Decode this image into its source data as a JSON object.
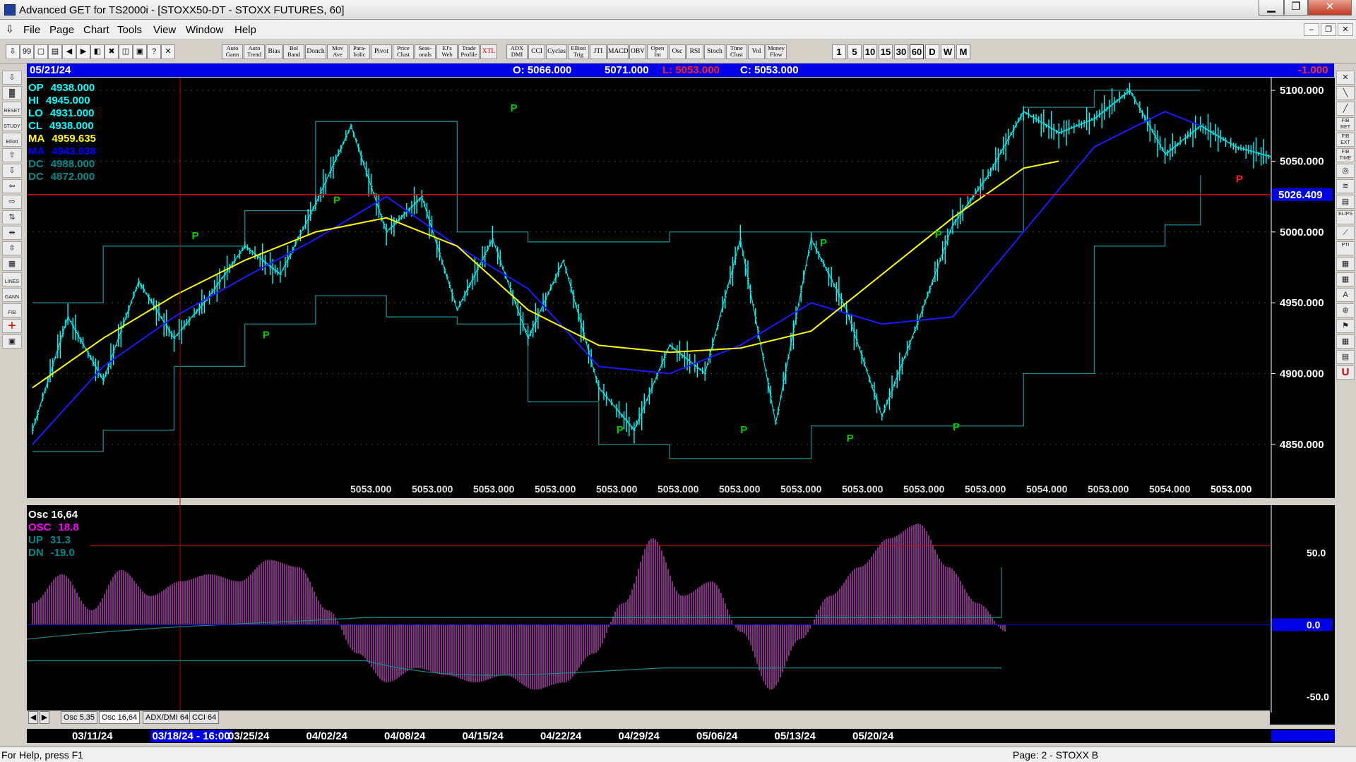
{
  "window": {
    "title": "Advanced GET for TS2000i - [STOXX50-DT - STOXX FUTURES, 60]",
    "btn_min": "▁",
    "btn_max": "❐",
    "btn_close": "✕"
  },
  "menu": {
    "items": [
      "File",
      "Page",
      "Chart",
      "Tools",
      "View",
      "Window",
      "Help"
    ],
    "mdi_min": "‒",
    "mdi_restore": "❐",
    "mdi_close": "✕"
  },
  "toolbar": {
    "file_buttons": [
      "⇩",
      "99",
      "▢",
      "▤",
      "◀",
      "▶",
      "◧",
      "✖",
      "◫",
      "▣",
      "?",
      "✕"
    ],
    "indicators": [
      "Auto\nGann",
      "Auto\nTrend",
      "Bias",
      "Bol\nBand",
      "Donch",
      "Mov\nAve",
      "Para-\nbolic",
      "Pivot",
      "Price\nClust",
      "Seas-\nonals",
      "EJ's\nWeb",
      "Trade\nProfile",
      "XTL",
      "ADX\nDMI",
      "CCI",
      "Cycles",
      "Elliott\nTrig",
      "JTI",
      "MACD",
      "OBV",
      "Open\nInt",
      "Osc",
      "RSI",
      "Stoch",
      "Time\nClust",
      "Vol",
      "Money\nFlow"
    ],
    "intervals": [
      "1",
      "5",
      "10",
      "15",
      "30",
      "60",
      "D",
      "W",
      "M"
    ],
    "active_interval": "60"
  },
  "left_tools": [
    "⇩",
    "▓",
    "RESET",
    "STUDY",
    "Elliott",
    "⇧",
    "⇩",
    "⇦",
    "⇨",
    "⇅",
    "⇹",
    "⇳",
    "▦",
    "LINES",
    "GANN",
    "FIB",
    "+",
    "▣"
  ],
  "right_tools": [
    "✕",
    "╲",
    "╱",
    "FIB RET",
    "FIB EXT",
    "FIB TIME",
    "◎",
    "≋",
    "▤",
    "ELIPS",
    "⟋",
    "PTI",
    "▦",
    "▦",
    "A",
    "⊕",
    "⚑",
    "▦",
    "▤",
    "U"
  ],
  "infobar": {
    "date": "05/21/24",
    "open": "O: 5066.000",
    "high": "5071.000",
    "low": "L: 5053.000",
    "close": "C: 5053.000",
    "change": "-1.000"
  },
  "price_panel": {
    "overlay": [
      {
        "label": "OP",
        "value": "4938.000",
        "color": "#00ffff"
      },
      {
        "label": "HI",
        "value": "4945.000",
        "color": "#00ffff"
      },
      {
        "label": "LO",
        "value": "4931.000",
        "color": "#00ffff"
      },
      {
        "label": "CL",
        "value": "4938.000",
        "color": "#00ffff"
      },
      {
        "label": "MA",
        "value": "4959.635",
        "color": "#ffff00"
      },
      {
        "label": "MA",
        "value": "4943.938",
        "color": "#0000ff"
      },
      {
        "label": "DC",
        "value": "4988.000",
        "color": "#008b8b"
      },
      {
        "label": "DC",
        "value": "4872.000",
        "color": "#008b8b"
      }
    ],
    "y_axis": [
      "5100.000",
      "5050.000",
      "5000.000",
      "4950.000",
      "4900.000",
      "4850.000"
    ],
    "current_price": "5026.409",
    "bottom_labels": [
      "5053.000",
      "5053.000",
      "5053.000",
      "5053.000",
      "5053.000",
      "5053.000",
      "5053.000",
      "5053.000",
      "5053.000",
      "5053.000",
      "5053.000",
      "5054.000",
      "5053.000",
      "5054.000",
      "5053.000"
    ],
    "pivot_marker": "P"
  },
  "osc_panel": {
    "overlay": [
      {
        "label": "Osc 16,64",
        "value": "",
        "color": "#ffffff"
      },
      {
        "label": "OSC",
        "value": "18.8",
        "color": "#ff00ff"
      },
      {
        "label": "UP",
        "value": "31.3",
        "color": "#008b8b"
      },
      {
        "label": "DN",
        "value": "-19.0",
        "color": "#008b8b"
      }
    ],
    "y_axis": [
      "50.0",
      "0.0",
      "-50.0"
    ]
  },
  "chart_data": {
    "type": "line",
    "title": "STOXX50-DT - STOXX FUTURES, 60",
    "x_dates": [
      "03/11/24",
      "03/18/24",
      "03/25/24",
      "04/02/24",
      "04/08/24",
      "04/15/24",
      "04/22/24",
      "04/29/24",
      "05/06/24",
      "05/13/24",
      "05/20/24"
    ],
    "ylim": [
      4830,
      5105
    ],
    "series": [
      {
        "name": "Close",
        "color": "#00ffff",
        "x": [
          0,
          2,
          4,
          6,
          8,
          10,
          12,
          14,
          16,
          18,
          20,
          22,
          24,
          26,
          28,
          30,
          32,
          34,
          36,
          38,
          40,
          42,
          44,
          46,
          48,
          50,
          52,
          54,
          56,
          58,
          60,
          62,
          64,
          66,
          68,
          70
        ],
        "values": [
          4860,
          4940,
          4895,
          4965,
          4925,
          4955,
          4990,
          4970,
          5020,
          5075,
          5000,
          5025,
          4945,
          4995,
          4925,
          4980,
          4890,
          4860,
          4920,
          4900,
          4995,
          4865,
          4995,
          4945,
          4870,
          4935,
          5005,
          5040,
          5085,
          5070,
          5080,
          5100,
          5055,
          5075,
          5060,
          5053
        ]
      },
      {
        "name": "MA",
        "color": "#ffff00",
        "x": [
          0,
          4,
          8,
          12,
          16,
          20,
          24,
          28,
          32,
          36,
          40,
          44,
          48,
          52,
          56,
          58
        ],
        "values": [
          4890,
          4925,
          4955,
          4980,
          5000,
          5010,
          4990,
          4945,
          4920,
          4915,
          4918,
          4930,
          4970,
          5010,
          5045,
          5050
        ]
      },
      {
        "name": "MA",
        "color": "#0000ff",
        "x": [
          0,
          4,
          8,
          12,
          16,
          20,
          24,
          28,
          32,
          36,
          40,
          44,
          48,
          52,
          56,
          60,
          64,
          66
        ],
        "values": [
          4850,
          4905,
          4940,
          4968,
          4995,
          5025,
          4990,
          4960,
          4905,
          4900,
          4920,
          4950,
          4935,
          4940,
          5000,
          5060,
          5085,
          5075
        ]
      },
      {
        "name": "DC",
        "color": "#008b8b",
        "x": [
          0,
          4,
          8,
          12,
          16,
          20,
          24,
          28,
          32,
          36,
          40,
          44,
          48,
          52,
          56,
          60,
          64,
          66
        ],
        "values": [
          4950,
          4990,
          4990,
          5015,
          5078,
          5078,
          5000,
          4993,
          4993,
          5000,
          5000,
          5000,
          5000,
          5000,
          5088,
          5100,
          5100,
          5100
        ]
      },
      {
        "name": "DC",
        "color": "#008b8b",
        "x": [
          0,
          4,
          8,
          12,
          16,
          20,
          24,
          28,
          32,
          36,
          40,
          44,
          48,
          52,
          56,
          60,
          64,
          66
        ],
        "values": [
          4845,
          4860,
          4905,
          4935,
          4955,
          4940,
          4935,
          4880,
          4850,
          4840,
          4840,
          4863,
          4863,
          4863,
          4900,
          4990,
          5005,
          5040
        ]
      }
    ],
    "oscillator": {
      "name": "Osc 16,64",
      "ylim": [
        -60,
        80
      ],
      "x": [
        0,
        2,
        4,
        6,
        8,
        10,
        12,
        14,
        16,
        18,
        20,
        22,
        24,
        26,
        28,
        30,
        32,
        34,
        36,
        38,
        40,
        42,
        44,
        46,
        48,
        50,
        52,
        54,
        56,
        58,
        60,
        62,
        64,
        66
      ],
      "values": [
        15,
        35,
        10,
        38,
        20,
        30,
        35,
        30,
        45,
        40,
        10,
        -20,
        -40,
        -30,
        -35,
        -40,
        -35,
        -45,
        -40,
        -20,
        15,
        60,
        20,
        30,
        -5,
        -45,
        -10,
        20,
        40,
        60,
        70,
        40,
        15,
        -5
      ],
      "up_level": 55,
      "dn_level": -25
    }
  }
}
